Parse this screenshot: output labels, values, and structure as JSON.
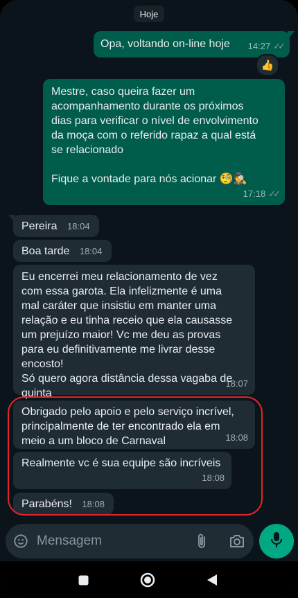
{
  "date_chip": "Hoje",
  "messages": [
    {
      "text": "Opa, voltando on-line hoje",
      "time": "14:27"
    },
    {
      "text": "Mestre, caso queira fazer um\nacompanhamento durante os próximos\ndias para verificar o nível de envolvimento\nda moça com o referido rapaz a qual está\nse relacionado\n\nFique a vontade para nós acionar 🧐🕵️",
      "time": "17:18"
    },
    {
      "text": "Pereira",
      "time": "18:04"
    },
    {
      "text": "Boa tarde",
      "time": "18:04"
    },
    {
      "text": "Eu encerrei meu relacionamento de vez\ncom essa garota. Ela infelizmente é uma\nmal caráter que insistiu em manter uma\nrelação e eu tinha receio que ela causasse\num prejuízo maior! Vc me deu as provas\npara eu definitivamente me livrar desse\nencosto!\nSó quero agora distância dessa vagaba de\nquinta",
      "time": "18:07"
    },
    {
      "text": "Obrigado pelo apoio e pelo serviço incrível,\nprincipalmente de ter encontrado ela em\nmeio a um bloco de Carnaval",
      "time": "18:08"
    },
    {
      "text": "Realmente vc é sua equipe são incríveis",
      "time": "18:08"
    },
    {
      "text": "Parabéns!",
      "time": "18:08"
    }
  ],
  "reaction": "👍",
  "input": {
    "placeholder": "Mensagem"
  },
  "icons": {
    "sticker": "sticker-icon",
    "attach": "paperclip-icon",
    "camera": "camera-icon",
    "mic": "microphone-icon",
    "nav_recents": "square-icon",
    "nav_home": "circle-icon",
    "nav_back": "triangle-back-icon"
  },
  "colors": {
    "background": "#0b141a",
    "outgoing": "#005c4b",
    "incoming": "#202c33",
    "accent": "#00a884",
    "highlight": "#e0262a"
  }
}
